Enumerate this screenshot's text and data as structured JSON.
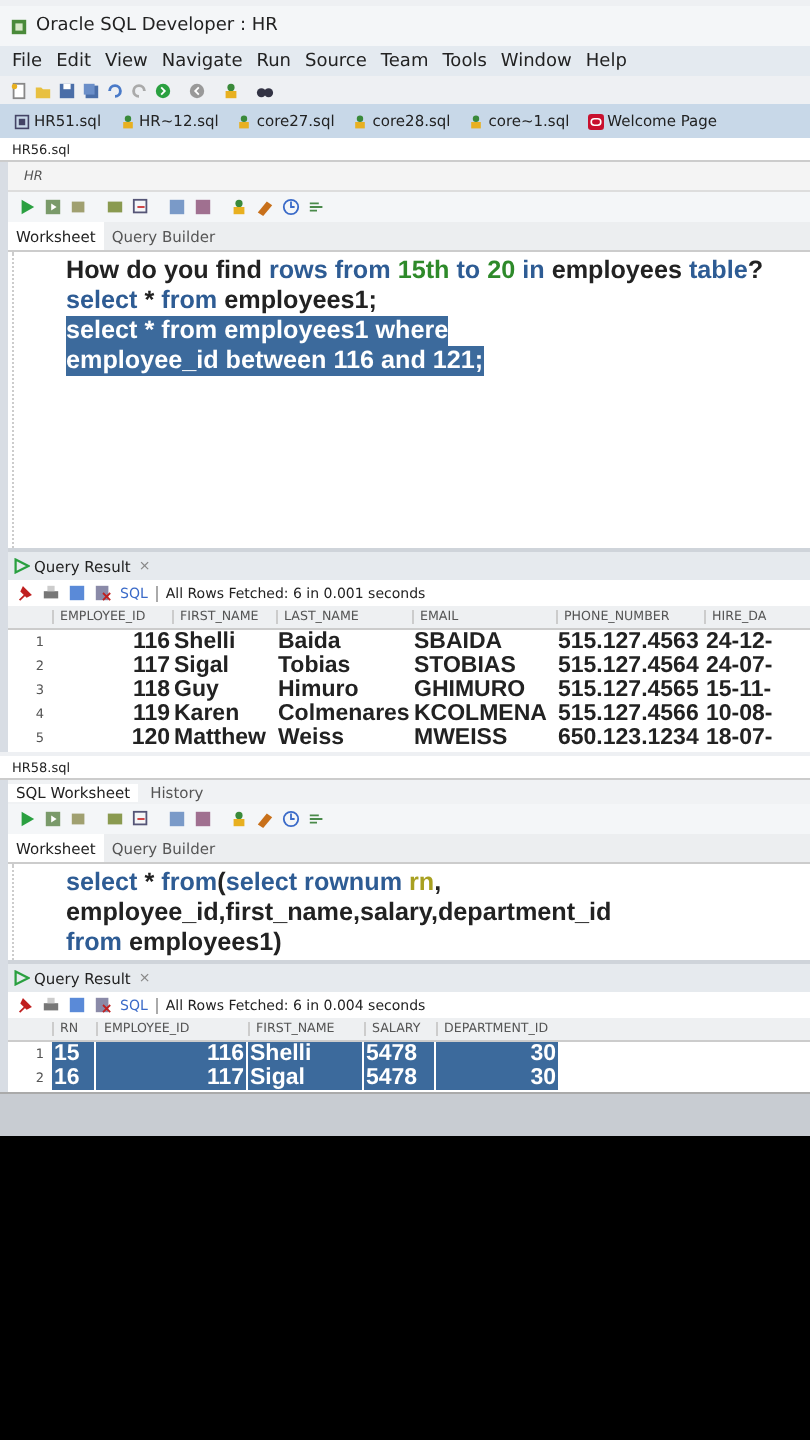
{
  "window": {
    "title": "Oracle SQL Developer : HR"
  },
  "menu": [
    "File",
    "Edit",
    "View",
    "Navigate",
    "Run",
    "Source",
    "Team",
    "Tools",
    "Window",
    "Help"
  ],
  "doc_tabs": [
    {
      "label": "HR51.sql",
      "selected": false
    },
    {
      "label": "HR~12.sql",
      "selected": false
    },
    {
      "label": "core27.sql",
      "selected": false
    },
    {
      "label": "core28.sql",
      "selected": false
    },
    {
      "label": "core~1.sql",
      "selected": false
    },
    {
      "label": "Welcome Page",
      "selected": false
    }
  ],
  "top_panel": {
    "file_tab": "HR56.sql",
    "connection": "HR",
    "editor_tabs": [
      {
        "label": "Worksheet",
        "selected": true
      },
      {
        "label": "Query Builder",
        "selected": false
      }
    ],
    "lines": [
      {
        "selected": false,
        "tokens": [
          {
            "kind": "plain",
            "text": "How do you find"
          },
          {
            "kind": "keyword",
            "text": "rows from"
          },
          {
            "kind": "number",
            "text": "15th"
          },
          {
            "kind": "keyword",
            "text": "to"
          },
          {
            "kind": "number",
            "text": "20"
          },
          {
            "kind": "keyword",
            "text": "in"
          },
          {
            "kind": "plain",
            "text": "employees"
          },
          {
            "kind": "keyword",
            "text": "table"
          },
          {
            "kind": "glued",
            "text": "?"
          }
        ]
      },
      {
        "selected": false,
        "tokens": [
          {
            "kind": "keyword",
            "text": "select"
          },
          {
            "kind": "plain",
            "text": "*"
          },
          {
            "kind": "keyword",
            "text": "from"
          },
          {
            "kind": "plain",
            "text": "employees1;"
          }
        ]
      },
      {
        "selected": true,
        "tokens": [
          {
            "kind": "keyword",
            "text": "select"
          },
          {
            "kind": "plain",
            "text": "*"
          },
          {
            "kind": "keyword",
            "text": "from"
          },
          {
            "kind": "plain",
            "text": "employees1"
          },
          {
            "kind": "keyword",
            "text": "where"
          }
        ]
      },
      {
        "selected": true,
        "tokens": [
          {
            "kind": "plain",
            "text": "employee_id"
          },
          {
            "kind": "keyword",
            "text": "between"
          },
          {
            "kind": "number",
            "text": "116"
          },
          {
            "kind": "keyword",
            "text": "and"
          },
          {
            "kind": "number",
            "text": "121;"
          }
        ]
      }
    ],
    "result": {
      "tab": "Query Result",
      "close": "×",
      "sql": "SQL",
      "status": "All Rows Fetched: 6 in 0.001 seconds",
      "columns": [
        "EMPLOYEE_ID",
        "FIRST_NAME",
        "LAST_NAME",
        "EMAIL",
        "PHONE_NUMBER",
        "HIRE_DA"
      ],
      "rows": [
        {
          "num": "1",
          "cells": [
            "116",
            "Shelli",
            "Baida",
            "SBAIDA",
            "515.127.4563",
            "24-12-"
          ]
        },
        {
          "num": "2",
          "cells": [
            "117",
            "Sigal",
            "Tobias",
            "STOBIAS",
            "515.127.4564",
            "24-07-"
          ]
        },
        {
          "num": "3",
          "cells": [
            "118",
            "Guy",
            "Himuro",
            "GHIMURO",
            "515.127.4565",
            "15-11-"
          ]
        },
        {
          "num": "4",
          "cells": [
            "119",
            "Karen",
            "Colmenares",
            "KCOLMENA",
            "515.127.4566",
            "10-08-"
          ]
        },
        {
          "num": "5",
          "cells": [
            "120",
            "Matthew",
            "Weiss",
            "MWEISS",
            "650.123.1234",
            "18-07-"
          ]
        }
      ]
    }
  },
  "bottom_panel": {
    "file_tab": "HR58.sql",
    "panel_tabs": [
      {
        "label": "SQL Worksheet",
        "selected": true
      },
      {
        "label": "History",
        "selected": false
      }
    ],
    "editor_tabs": [
      {
        "label": "Worksheet",
        "selected": true
      },
      {
        "label": "Query Builder",
        "selected": false
      }
    ],
    "lines": [
      {
        "selected": false,
        "tokens": [
          {
            "kind": "keyword",
            "text": "select"
          },
          {
            "kind": "plain",
            "text": "*"
          },
          {
            "kind": "keyword",
            "text": "from"
          },
          {
            "kind": "glued",
            "text": "("
          },
          {
            "kind": "glued_keyword",
            "text": "select"
          },
          {
            "kind": "keyword",
            "text": "rownum"
          },
          {
            "kind": "alias",
            "text": "rn"
          },
          {
            "kind": "glued",
            "text": ","
          }
        ]
      },
      {
        "selected": false,
        "tokens": [
          {
            "kind": "plain",
            "text": "employee_id,first_name,salary,department_id"
          }
        ]
      },
      {
        "selected": false,
        "tokens": [
          {
            "kind": "keyword",
            "text": "from"
          },
          {
            "kind": "plain",
            "text": "employees1)"
          }
        ]
      }
    ],
    "result": {
      "tab": "Query Result",
      "close": "×",
      "sql": "SQL",
      "status": "All Rows Fetched: 6 in 0.004 seconds",
      "columns": [
        "RN",
        "EMPLOYEE_ID",
        "FIRST_NAME",
        "SALARY",
        "DEPARTMENT_ID"
      ],
      "rows": [
        {
          "num": "1",
          "selected": true,
          "cells": [
            "15",
            "116",
            "Shelli",
            "5478",
            "30"
          ]
        },
        {
          "num": "2",
          "selected": true,
          "cells": [
            "16",
            "117",
            "Sigal",
            "5478",
            "30"
          ]
        }
      ]
    }
  }
}
